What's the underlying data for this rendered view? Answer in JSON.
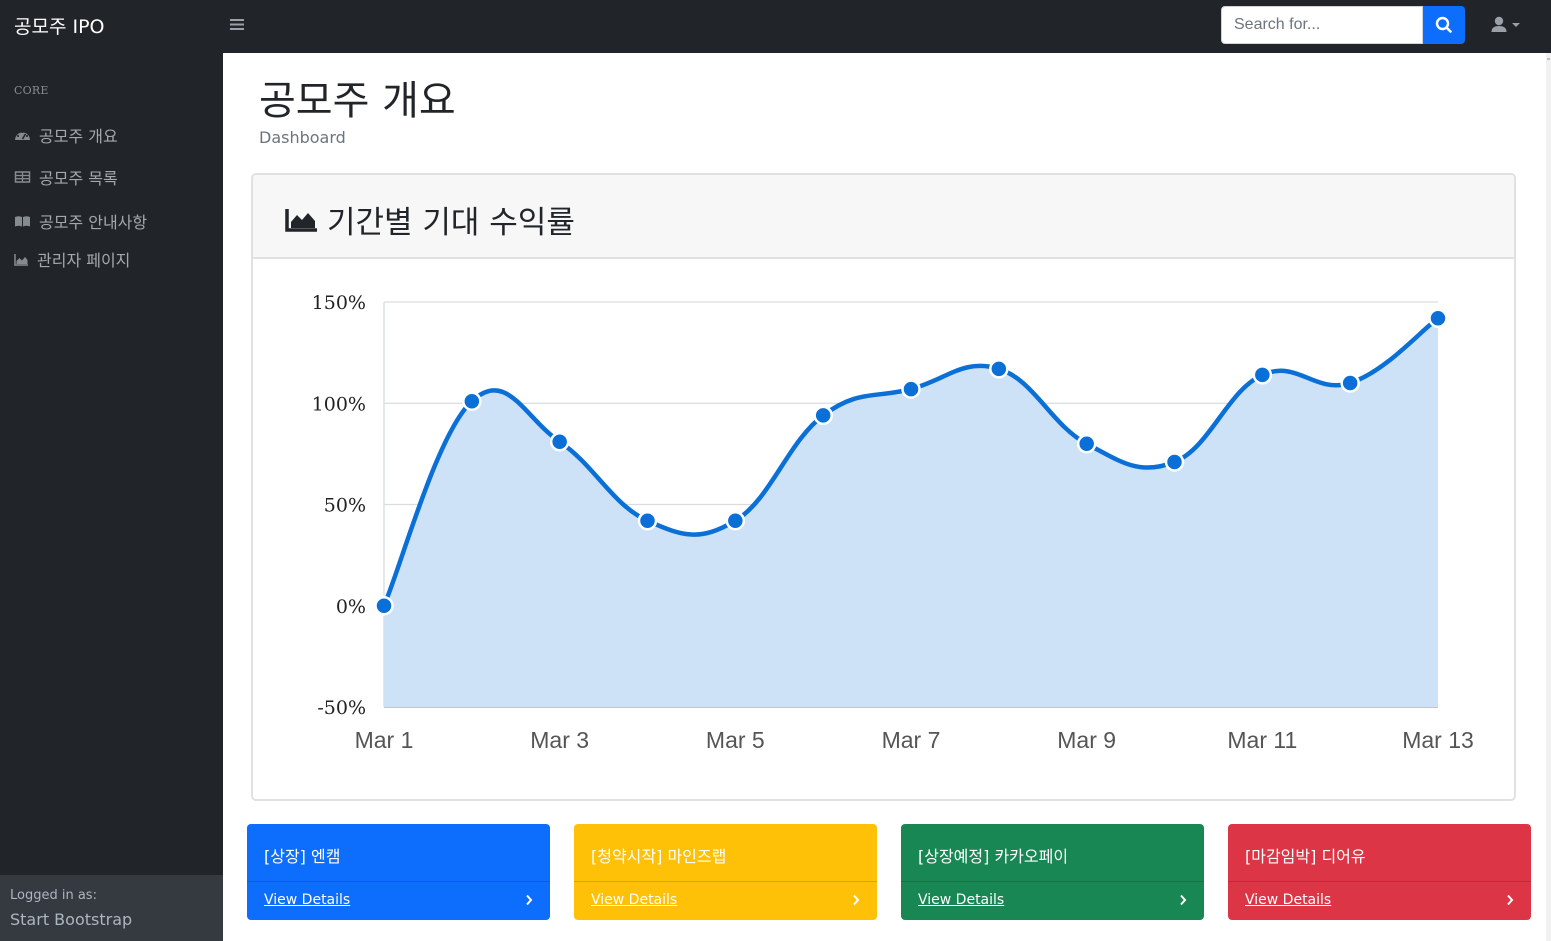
{
  "navbar": {
    "brand": "공모주 IPO",
    "search_placeholder": "Search for..."
  },
  "sidebar": {
    "heading": "CORE",
    "items": [
      {
        "label": "공모주 개요",
        "icon": "tachometer-icon"
      },
      {
        "label": "공모주 목록",
        "icon": "table-icon"
      },
      {
        "label": "공모주 안내사항",
        "icon": "book-icon"
      },
      {
        "label": "관리자 페이지",
        "icon": "area-chart-icon"
      }
    ],
    "footer": {
      "label": "Logged in as:",
      "user": "Start Bootstrap"
    }
  },
  "page": {
    "title": "공모주 개요",
    "breadcrumb": "Dashboard"
  },
  "chart_card": {
    "title": "기간별 기대 수익률"
  },
  "chart_data": {
    "type": "area",
    "x": [
      "Mar 1",
      "Mar 2",
      "Mar 3",
      "Mar 4",
      "Mar 5",
      "Mar 6",
      "Mar 7",
      "Mar 8",
      "Mar 9",
      "Mar 10",
      "Mar 11",
      "Mar 12",
      "Mar 13"
    ],
    "x_tick_labels": [
      "Mar 1",
      "Mar 3",
      "Mar 5",
      "Mar 7",
      "Mar 9",
      "Mar 11",
      "Mar 13"
    ],
    "values": [
      0,
      101,
      81,
      42,
      42,
      94,
      107,
      117,
      80,
      71,
      114,
      110,
      142
    ],
    "y_tick_labels": [
      "150%",
      "100%",
      "50%",
      "0%",
      "-50%"
    ],
    "y_ticks": [
      150,
      100,
      50,
      0,
      -50
    ],
    "ylim": [
      -50,
      150
    ],
    "grid": true,
    "line_color": "#0a6fd6",
    "fill_color": "#cde2f6"
  },
  "status_cards": [
    {
      "title": "[상장] 엔캠",
      "link": "View Details",
      "color": "#0d6efd"
    },
    {
      "title": "[청약시작] 마인즈랩",
      "link": "View Details",
      "color": "#ffc107"
    },
    {
      "title": "[상장예정] 카카오페이",
      "link": "View Details",
      "color": "#198754"
    },
    {
      "title": "[마감임박] 디어유",
      "link": "View Details",
      "color": "#dc3545"
    }
  ]
}
